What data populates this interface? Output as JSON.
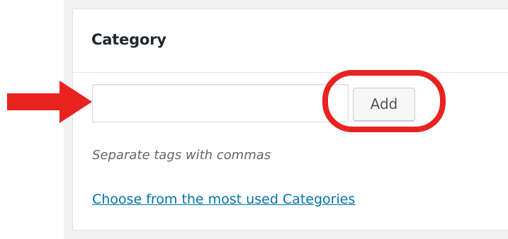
{
  "metabox": {
    "title": "Category",
    "input_value": "",
    "add_label": "Add",
    "hint": "Separate tags with commas",
    "choose_link": "Choose from the most used Categories"
  },
  "annotations": {
    "arrow_color": "#e8231f",
    "circle_color": "#e8231f"
  },
  "colors": {
    "link": "#0073aa",
    "title": "#23282d",
    "hint": "#666666",
    "page_bg": "#f1f1f1"
  }
}
